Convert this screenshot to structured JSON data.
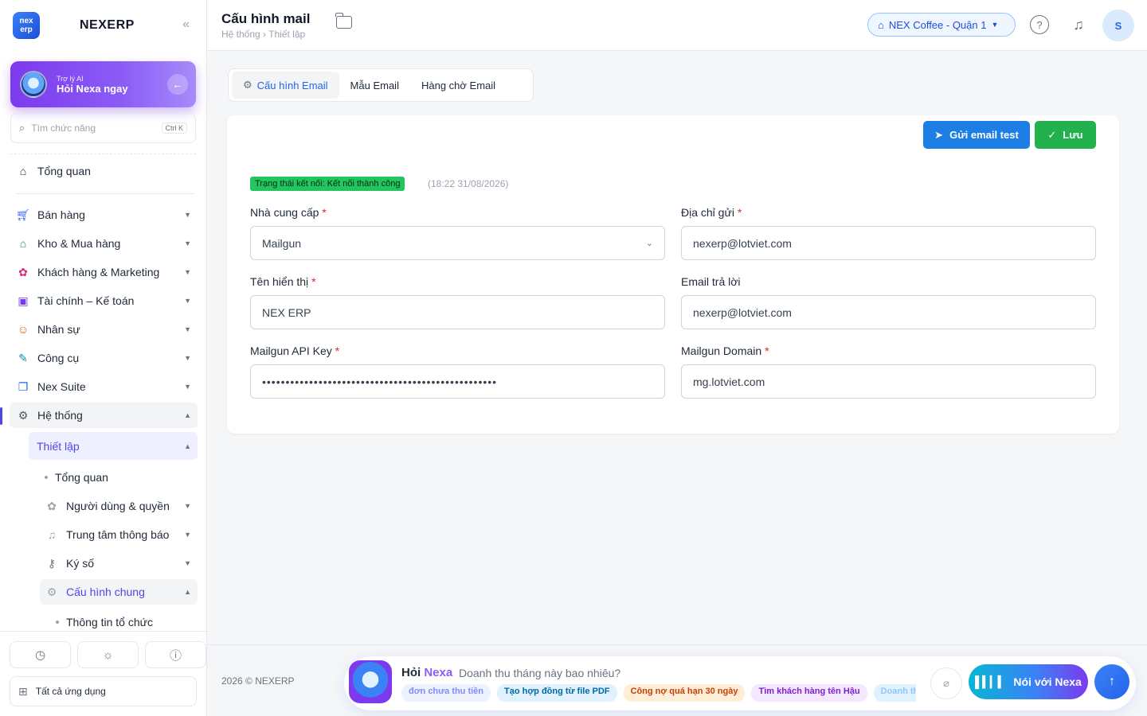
{
  "brand": {
    "logo_text": "nex erp",
    "name": "NEXERP"
  },
  "ai_card": {
    "small": "Trợ lý AI",
    "title": "Hỏi Nexa ngay"
  },
  "search": {
    "placeholder": "Tìm chức năng",
    "shortcut": "Ctrl K"
  },
  "sidebar": {
    "overview": "Tổng quan",
    "items": [
      {
        "label": "Bán hàng",
        "icon": "cart-icon"
      },
      {
        "label": "Kho & Mua hàng",
        "icon": "bag-icon"
      },
      {
        "label": "Khách hàng & Marketing",
        "icon": "users-icon"
      },
      {
        "label": "Tài chính – Kế toán",
        "icon": "calculator-icon"
      },
      {
        "label": "Nhân sự",
        "icon": "person-icon"
      },
      {
        "label": "Công cụ",
        "icon": "wrench-icon"
      },
      {
        "label": "Nex Suite",
        "icon": "document-icon"
      },
      {
        "label": "Hệ thống",
        "icon": "gear-icon"
      }
    ],
    "sub_setup": "Thiết lập",
    "sub_items": [
      {
        "label": "Tổng quan"
      },
      {
        "label": "Người dùng & quyền"
      },
      {
        "label": "Trung tâm thông báo"
      },
      {
        "label": "Ký số"
      },
      {
        "label": "Cấu hình chung"
      },
      {
        "label": "Thông tin tổ chức"
      }
    ],
    "all_apps": "Tất cả ứng dụng"
  },
  "header": {
    "title": "Cấu hình mail",
    "breadcrumb": "Hệ thống › Thiết lập",
    "branch": "NEX Coffee - Quận 1",
    "avatar": "S"
  },
  "tabs": [
    {
      "label": "Cấu hình Email"
    },
    {
      "label": "Mẫu Email"
    },
    {
      "label": "Hàng chờ Email"
    }
  ],
  "actions": {
    "send_test": "Gửi email test",
    "save": "Lưu"
  },
  "status": {
    "badge": "Trạng thái kết nối: Kết nối thành công",
    "time": "(18:22 31/08/2026)"
  },
  "form": {
    "provider_label": "Nhà cung cấp",
    "provider_value": "Mailgun",
    "from_label": "Địa chỉ gửi",
    "from_value": "nexerp@lotviet.com",
    "display_label": "Tên hiển thị",
    "display_value": "NEX ERP",
    "reply_label": "Email trả lời",
    "reply_value": "nexerp@lotviet.com",
    "apikey_label": "Mailgun API Key",
    "apikey_value": "••••••••••••••••••••••••••••••••••••••••••••••••••",
    "domain_label": "Mailgun Domain",
    "domain_value": "mg.lotviet.com",
    "required_mark": "*"
  },
  "footer": {
    "copyright": "2026 © NEXERP",
    "chat_title_prefix": "Hỏi",
    "chat_title_name": "Nexa",
    "chat_question": "Doanh thu tháng này bao nhiêu?",
    "chips": [
      {
        "label": "đơn chưa thu tiền",
        "color": "#eef2ff",
        "text": "#6366f1"
      },
      {
        "label": "Tạo hợp đồng từ file PDF",
        "color": "#e0f2fe",
        "text": "#0369a1"
      },
      {
        "label": "Công nợ quá hạn 30 ngày",
        "color": "#ffedd5",
        "text": "#c2410c"
      },
      {
        "label": "Tìm khách hàng tên Hậu",
        "color": "#f3e8ff",
        "text": "#7e22ce"
      },
      {
        "label": "Doanh thu tuần",
        "color": "#e0f2fe",
        "text": "#60a5fa"
      }
    ],
    "talk_button": "Nói với Nexa"
  },
  "colors": {
    "accent": "#4f46e5",
    "primary": "#1d7fe6",
    "success": "#22b14c"
  }
}
